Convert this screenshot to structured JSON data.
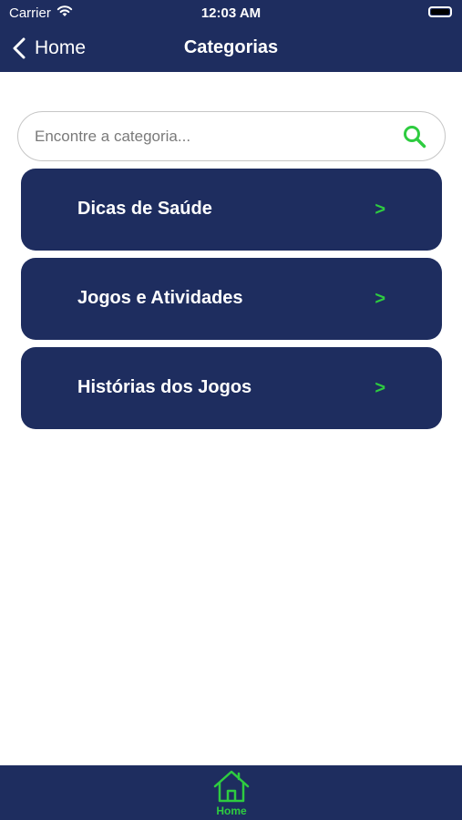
{
  "status_bar": {
    "carrier": "Carrier",
    "time": "12:03 AM"
  },
  "nav": {
    "back_label": "Home",
    "title": "Categorias"
  },
  "search": {
    "placeholder": "Encontre a categoria...",
    "value": ""
  },
  "categories": [
    {
      "label": "Dicas de Saúde",
      "arrow": ">"
    },
    {
      "label": "Jogos e Atividades",
      "arrow": ">"
    },
    {
      "label": "Histórias dos Jogos",
      "arrow": ">"
    }
  ],
  "tabbar": {
    "home_label": "Home"
  },
  "colors": {
    "primary": "#1e2d5f",
    "accent": "#2ecc40",
    "background": "#ffffff"
  },
  "icons": {
    "back": "chevron-left-icon",
    "search": "search-icon",
    "home": "home-icon",
    "wifi": "wifi-icon",
    "battery": "battery-icon"
  }
}
